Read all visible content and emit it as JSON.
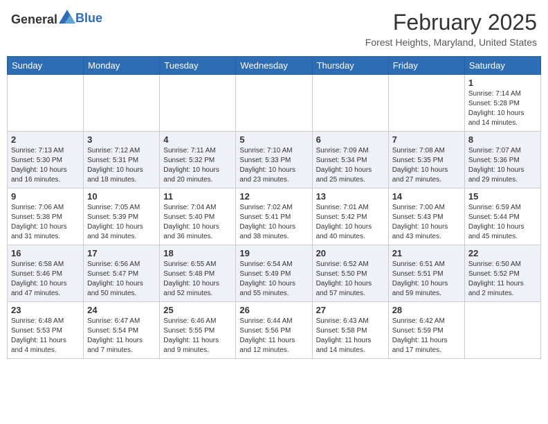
{
  "header": {
    "logo_general": "General",
    "logo_blue": "Blue",
    "month": "February 2025",
    "location": "Forest Heights, Maryland, United States"
  },
  "days_of_week": [
    "Sunday",
    "Monday",
    "Tuesday",
    "Wednesday",
    "Thursday",
    "Friday",
    "Saturday"
  ],
  "weeks": [
    [
      {
        "day": "",
        "info": ""
      },
      {
        "day": "",
        "info": ""
      },
      {
        "day": "",
        "info": ""
      },
      {
        "day": "",
        "info": ""
      },
      {
        "day": "",
        "info": ""
      },
      {
        "day": "",
        "info": ""
      },
      {
        "day": "1",
        "info": "Sunrise: 7:14 AM\nSunset: 5:28 PM\nDaylight: 10 hours\nand 14 minutes."
      }
    ],
    [
      {
        "day": "2",
        "info": "Sunrise: 7:13 AM\nSunset: 5:30 PM\nDaylight: 10 hours\nand 16 minutes."
      },
      {
        "day": "3",
        "info": "Sunrise: 7:12 AM\nSunset: 5:31 PM\nDaylight: 10 hours\nand 18 minutes."
      },
      {
        "day": "4",
        "info": "Sunrise: 7:11 AM\nSunset: 5:32 PM\nDaylight: 10 hours\nand 20 minutes."
      },
      {
        "day": "5",
        "info": "Sunrise: 7:10 AM\nSunset: 5:33 PM\nDaylight: 10 hours\nand 23 minutes."
      },
      {
        "day": "6",
        "info": "Sunrise: 7:09 AM\nSunset: 5:34 PM\nDaylight: 10 hours\nand 25 minutes."
      },
      {
        "day": "7",
        "info": "Sunrise: 7:08 AM\nSunset: 5:35 PM\nDaylight: 10 hours\nand 27 minutes."
      },
      {
        "day": "8",
        "info": "Sunrise: 7:07 AM\nSunset: 5:36 PM\nDaylight: 10 hours\nand 29 minutes."
      }
    ],
    [
      {
        "day": "9",
        "info": "Sunrise: 7:06 AM\nSunset: 5:38 PM\nDaylight: 10 hours\nand 31 minutes."
      },
      {
        "day": "10",
        "info": "Sunrise: 7:05 AM\nSunset: 5:39 PM\nDaylight: 10 hours\nand 34 minutes."
      },
      {
        "day": "11",
        "info": "Sunrise: 7:04 AM\nSunset: 5:40 PM\nDaylight: 10 hours\nand 36 minutes."
      },
      {
        "day": "12",
        "info": "Sunrise: 7:02 AM\nSunset: 5:41 PM\nDaylight: 10 hours\nand 38 minutes."
      },
      {
        "day": "13",
        "info": "Sunrise: 7:01 AM\nSunset: 5:42 PM\nDaylight: 10 hours\nand 40 minutes."
      },
      {
        "day": "14",
        "info": "Sunrise: 7:00 AM\nSunset: 5:43 PM\nDaylight: 10 hours\nand 43 minutes."
      },
      {
        "day": "15",
        "info": "Sunrise: 6:59 AM\nSunset: 5:44 PM\nDaylight: 10 hours\nand 45 minutes."
      }
    ],
    [
      {
        "day": "16",
        "info": "Sunrise: 6:58 AM\nSunset: 5:46 PM\nDaylight: 10 hours\nand 47 minutes."
      },
      {
        "day": "17",
        "info": "Sunrise: 6:56 AM\nSunset: 5:47 PM\nDaylight: 10 hours\nand 50 minutes."
      },
      {
        "day": "18",
        "info": "Sunrise: 6:55 AM\nSunset: 5:48 PM\nDaylight: 10 hours\nand 52 minutes."
      },
      {
        "day": "19",
        "info": "Sunrise: 6:54 AM\nSunset: 5:49 PM\nDaylight: 10 hours\nand 55 minutes."
      },
      {
        "day": "20",
        "info": "Sunrise: 6:52 AM\nSunset: 5:50 PM\nDaylight: 10 hours\nand 57 minutes."
      },
      {
        "day": "21",
        "info": "Sunrise: 6:51 AM\nSunset: 5:51 PM\nDaylight: 10 hours\nand 59 minutes."
      },
      {
        "day": "22",
        "info": "Sunrise: 6:50 AM\nSunset: 5:52 PM\nDaylight: 11 hours\nand 2 minutes."
      }
    ],
    [
      {
        "day": "23",
        "info": "Sunrise: 6:48 AM\nSunset: 5:53 PM\nDaylight: 11 hours\nand 4 minutes."
      },
      {
        "day": "24",
        "info": "Sunrise: 6:47 AM\nSunset: 5:54 PM\nDaylight: 11 hours\nand 7 minutes."
      },
      {
        "day": "25",
        "info": "Sunrise: 6:46 AM\nSunset: 5:55 PM\nDaylight: 11 hours\nand 9 minutes."
      },
      {
        "day": "26",
        "info": "Sunrise: 6:44 AM\nSunset: 5:56 PM\nDaylight: 11 hours\nand 12 minutes."
      },
      {
        "day": "27",
        "info": "Sunrise: 6:43 AM\nSunset: 5:58 PM\nDaylight: 11 hours\nand 14 minutes."
      },
      {
        "day": "28",
        "info": "Sunrise: 6:42 AM\nSunset: 5:59 PM\nDaylight: 11 hours\nand 17 minutes."
      },
      {
        "day": "",
        "info": ""
      }
    ]
  ]
}
